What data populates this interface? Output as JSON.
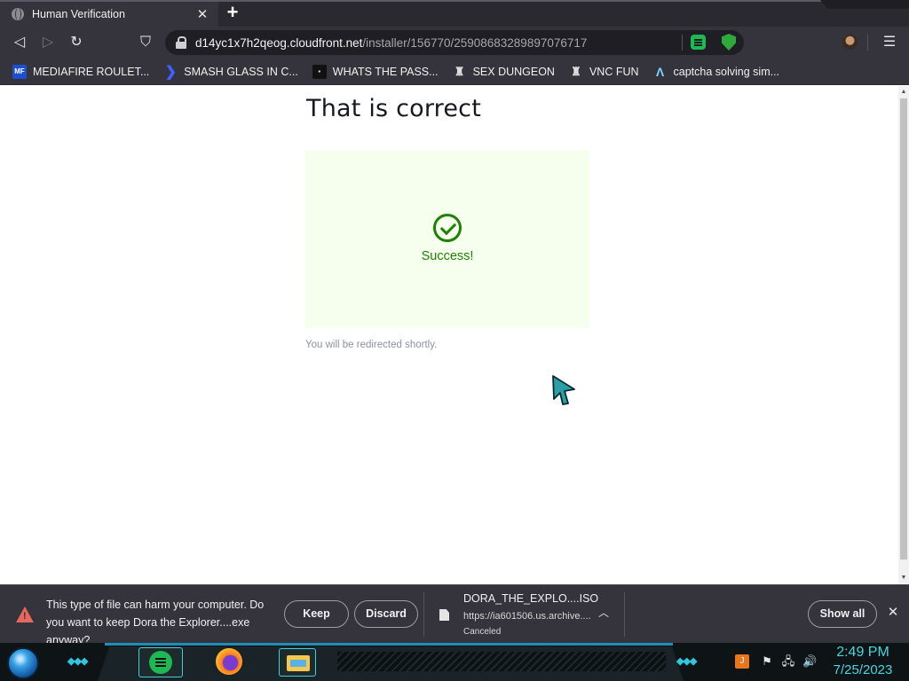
{
  "browser": {
    "tab": {
      "title": "Human Verification",
      "close_glyph": "✕",
      "new_tab_glyph": "+"
    },
    "toolbar": {
      "back_glyph": "◁",
      "forward_glyph": "▷",
      "reload_glyph": "↻",
      "bookmark_glyph": "⛉",
      "menu_glyph": "☰",
      "url_host": "d14yc1x7h2qeog.cloudfront.net",
      "url_path": "/installer/156770/2590868328989707671​7"
    },
    "bookmarks": [
      {
        "label": "MEDIAFIRE ROULET...",
        "icon": "mediafire-icon",
        "glyph": "MF"
      },
      {
        "label": "SMASH GLASS IN C...",
        "icon": "smash-icon",
        "glyph": "❯"
      },
      {
        "label": "WHATS THE PASS...",
        "icon": "password-icon",
        "glyph": "▪"
      },
      {
        "label": "SEX DUNGEON",
        "icon": "dungeon-icon",
        "glyph": "♜"
      },
      {
        "label": "VNC FUN",
        "icon": "vnc-icon",
        "glyph": "♜"
      },
      {
        "label": "captcha solving sim...",
        "icon": "captcha-icon",
        "glyph": "Λ"
      }
    ]
  },
  "page": {
    "heading": "That is correct",
    "success_text": "Success!",
    "redirect_text": "You will be redirected shortly."
  },
  "download_shelf": {
    "warning_text": "This type of file can harm your computer. Do you want to keep Dora the Explorer....exe anyway?",
    "keep_label": "Keep",
    "discard_label": "Discard",
    "file_name": "DORA_THE_EXPLO....ISO",
    "file_url": "https://ia601506.us.archive....",
    "file_status": "Canceled",
    "chevron_glyph": "︿",
    "show_all_label": "Show all",
    "close_glyph": "✕"
  },
  "taskbar": {
    "clock_time": "2:49 PM",
    "clock_date": "7/25/2023",
    "tray": {
      "flag_glyph": "⚑",
      "network_glyph": "🖧",
      "volume_glyph": "🔊",
      "java_glyph": "J"
    }
  },
  "colors": {
    "success_green": "#1d8102",
    "success_bg": "#f6ffed",
    "chrome_dark": "#35333b",
    "clock_cyan": "#46d6dd"
  }
}
